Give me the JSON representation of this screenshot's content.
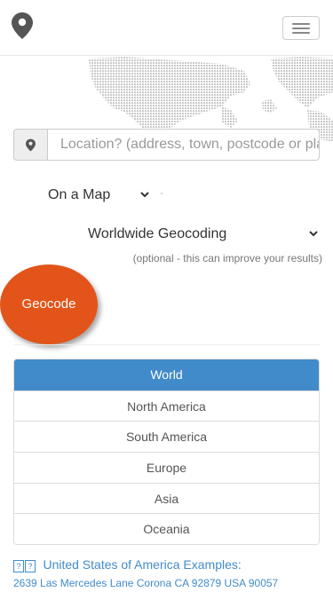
{
  "search": {
    "placeholder": "Location? (address, town, postcode or place)"
  },
  "map_type": {
    "selected": "On a Map",
    "separator": "-"
  },
  "region_select": {
    "selected": "Worldwide Geocoding",
    "hint": "(optional - this can improve your results)"
  },
  "geocode_button": {
    "label": "Geocode"
  },
  "regions": [
    {
      "label": "World",
      "active": true
    },
    {
      "label": "North America"
    },
    {
      "label": "South America"
    },
    {
      "label": "Europe"
    },
    {
      "label": "Asia"
    },
    {
      "label": "Oceania"
    }
  ],
  "examples": {
    "flag_glyphs": [
      "?",
      "?"
    ],
    "title": "United States of America Examples:",
    "address": "2639 Las Mercedes Lane Corona CA 92879 USA 90057"
  },
  "colors": {
    "accent": "#428bca",
    "geocode_button": "#e2541a",
    "logo": "#555555"
  },
  "icons": [
    "map-pin-logo-icon",
    "hamburger-menu-icon",
    "location-pin-icon",
    "chevron-down-icon"
  ]
}
